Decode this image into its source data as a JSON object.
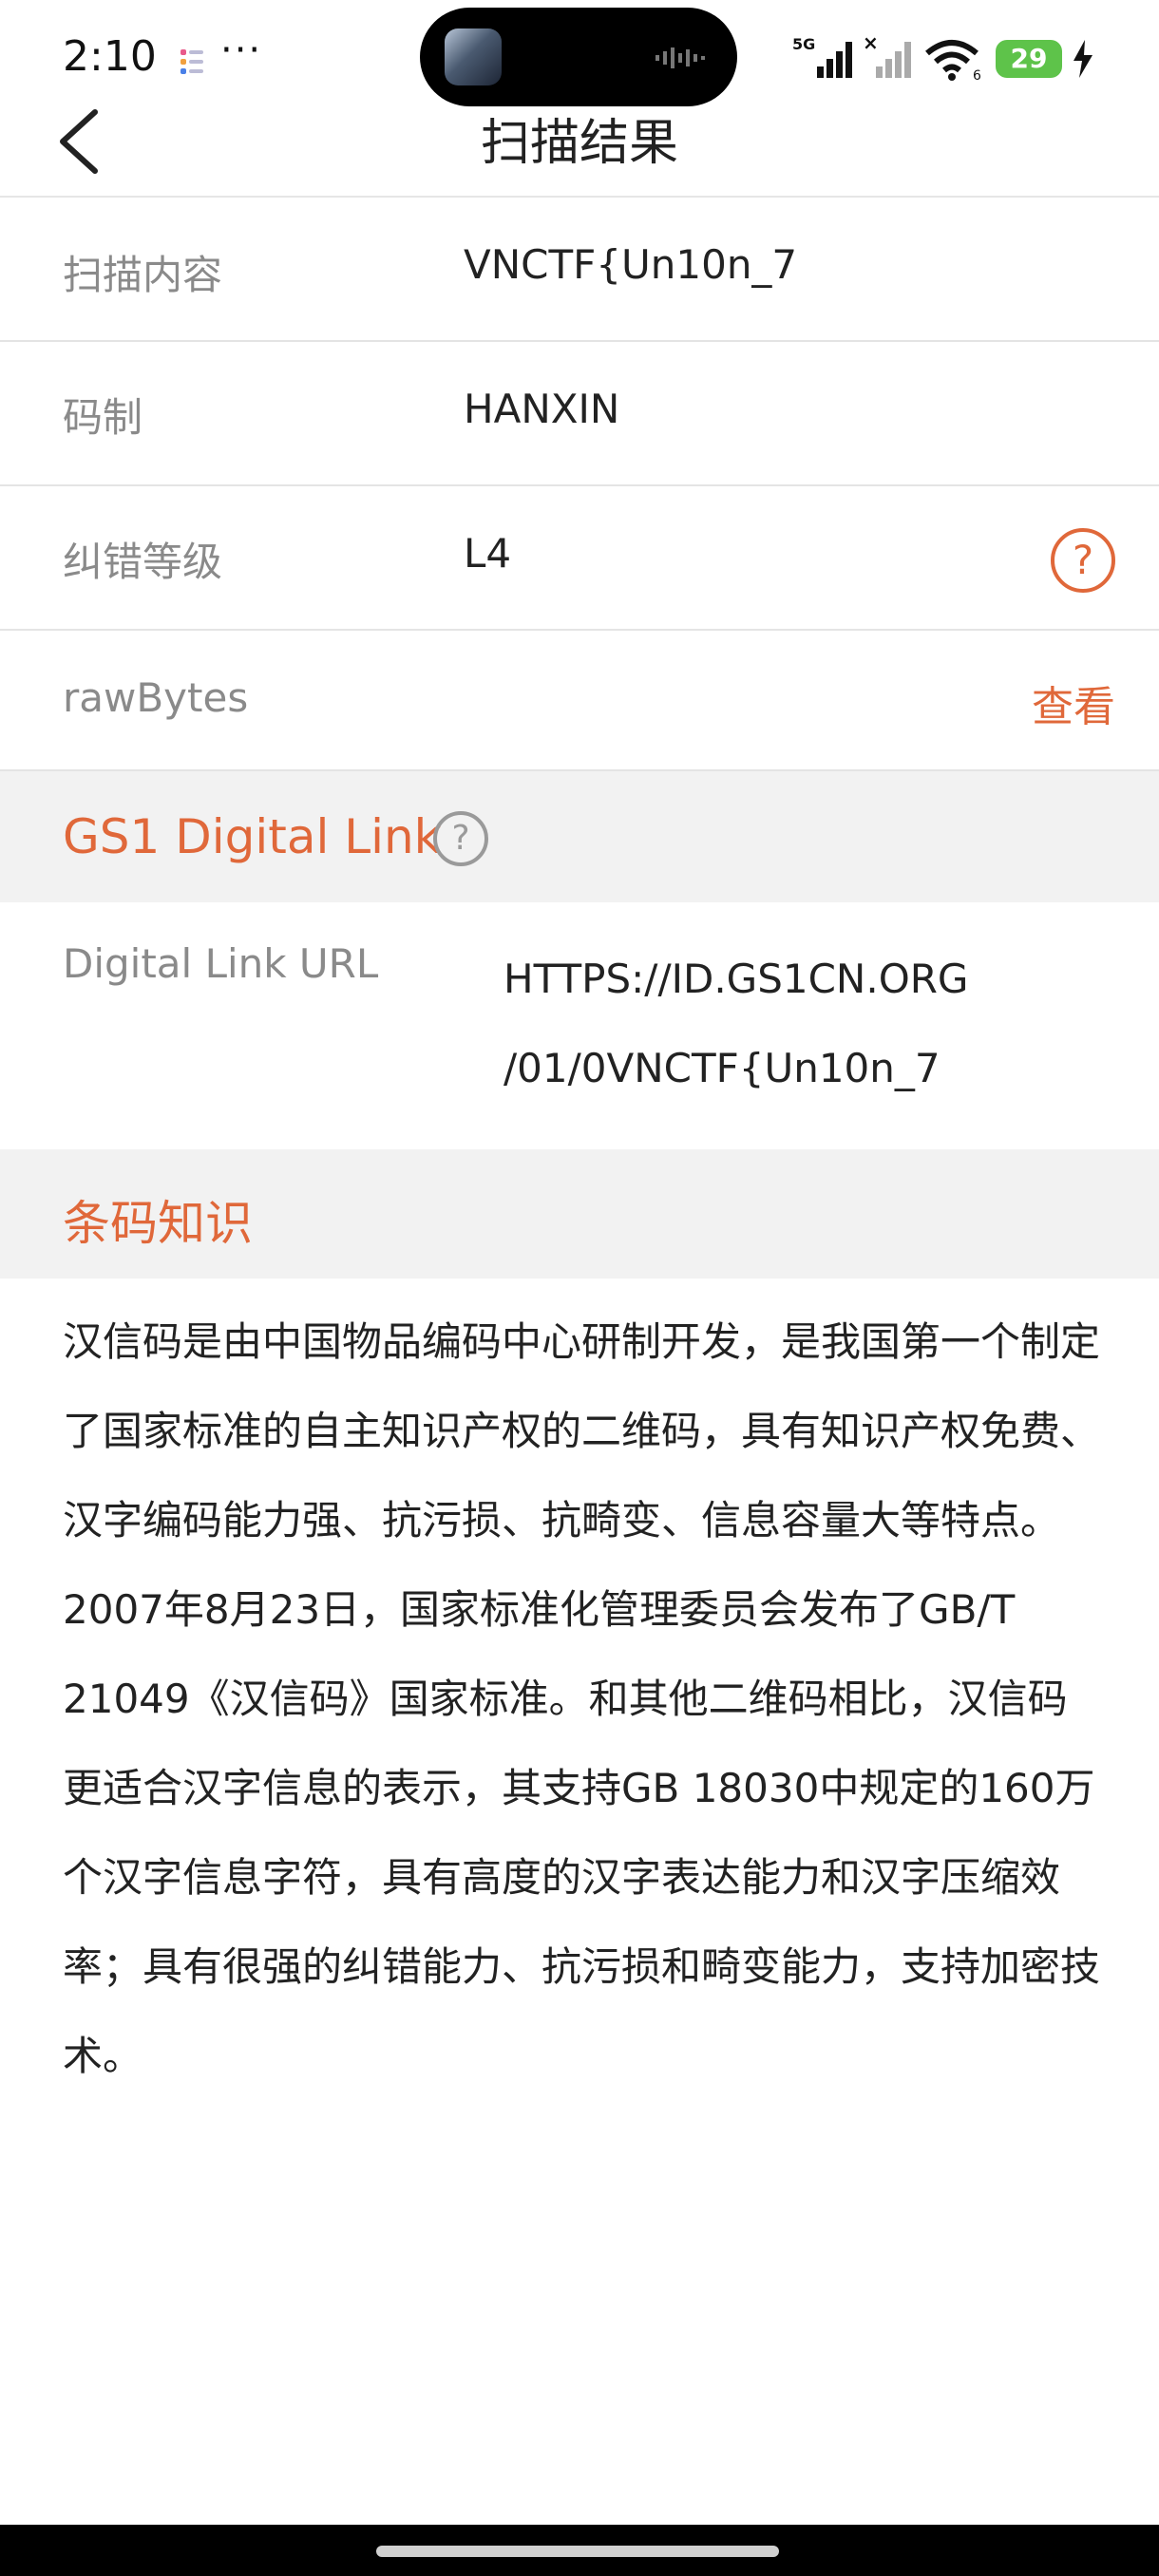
{
  "status_bar": {
    "time": "2:10",
    "more": "···",
    "network": "5G",
    "wifi_label": "6",
    "battery": "29"
  },
  "nav": {
    "title": "扫描结果"
  },
  "rows": [
    {
      "label": "扫描内容",
      "value": "VNCTF{Un10n_7"
    },
    {
      "label": "码制",
      "value": "HANXIN"
    },
    {
      "label": "纠错等级",
      "value": "L4",
      "help": "?"
    },
    {
      "label": "rawBytes",
      "action": "查看"
    }
  ],
  "gs1": {
    "title": "GS1 Digital Link",
    "help": "?",
    "url_label": "Digital Link URL",
    "url_line1": "HTTPS://ID.GS1CN.ORG",
    "url_line2": "/01/0VNCTF{Un10n_7"
  },
  "knowledge": {
    "title": "条码知识",
    "text": "汉信码是由中国物品编码中心研制开发，是我国第一个制定了国家标准的自主知识产权的二维码，具有知识产权免费、汉字编码能力强、抗污损、抗畸变、信息容量大等特点。2007年8月23日，国家标准化管理委员会发布了GB/T 21049《汉信码》国家标准。和其他二维码相比，汉信码更适合汉字信息的表示，其支持GB 18030中规定的160万个汉字信息字符，具有高度的汉字表达能力和汉字压缩效率；具有很强的纠错能力、抗污损和畸变能力，支持加密技术。"
  },
  "colors": {
    "accent": "#e0683a",
    "label": "#8a8a8a",
    "section_bg": "#f2f2f2"
  }
}
